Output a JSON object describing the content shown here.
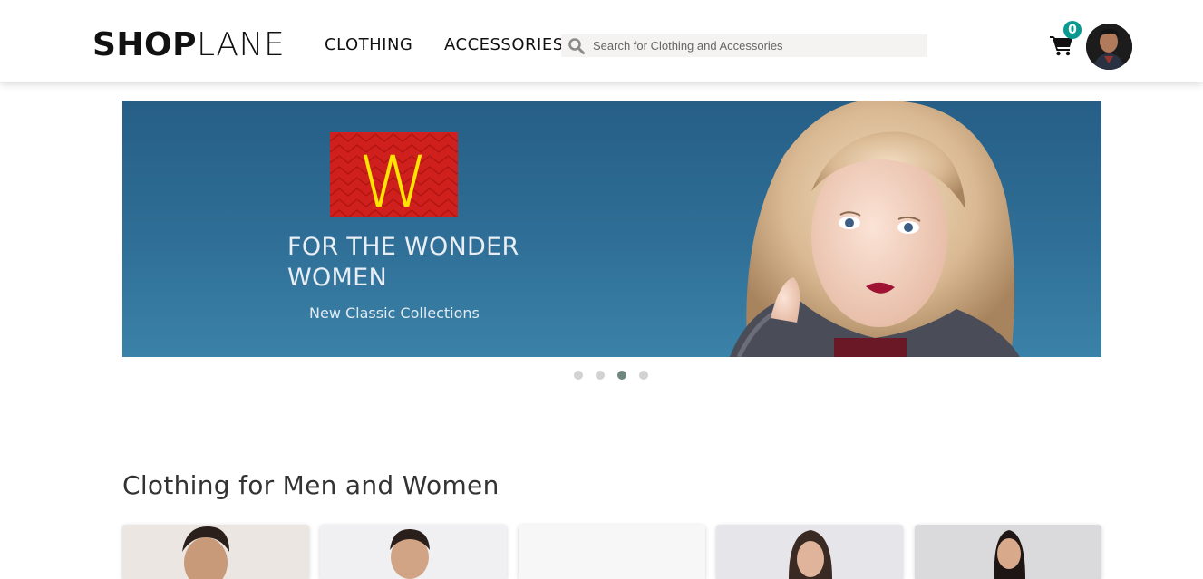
{
  "header": {
    "logo_bold": "SHOP",
    "logo_light": "LANE",
    "nav": [
      {
        "label": "CLOTHING"
      },
      {
        "label": "ACCESSORIES"
      }
    ],
    "search": {
      "placeholder": "Search for Clothing and Accessories",
      "icon": "search-icon"
    },
    "cart": {
      "count": "0",
      "icon": "shopping-cart-icon",
      "badge_color": "#099a8f"
    },
    "avatar": {
      "icon": "user-avatar"
    }
  },
  "banner": {
    "logo_letter": "W",
    "title": "FOR THE WONDER WOMEN",
    "subtitle": "New Classic Collections",
    "background_color": "#2f6f97",
    "logo_color": "#d0201d",
    "logo_letter_color": "#ffe600"
  },
  "carousel": {
    "dots": 4,
    "active_index": 2,
    "active_color": "#6f8680"
  },
  "section": {
    "title": "Clothing for Men and Women",
    "products": [
      {
        "name": "product-card-1"
      },
      {
        "name": "product-card-2"
      },
      {
        "name": "product-card-3"
      },
      {
        "name": "product-card-4"
      },
      {
        "name": "product-card-5"
      }
    ]
  }
}
